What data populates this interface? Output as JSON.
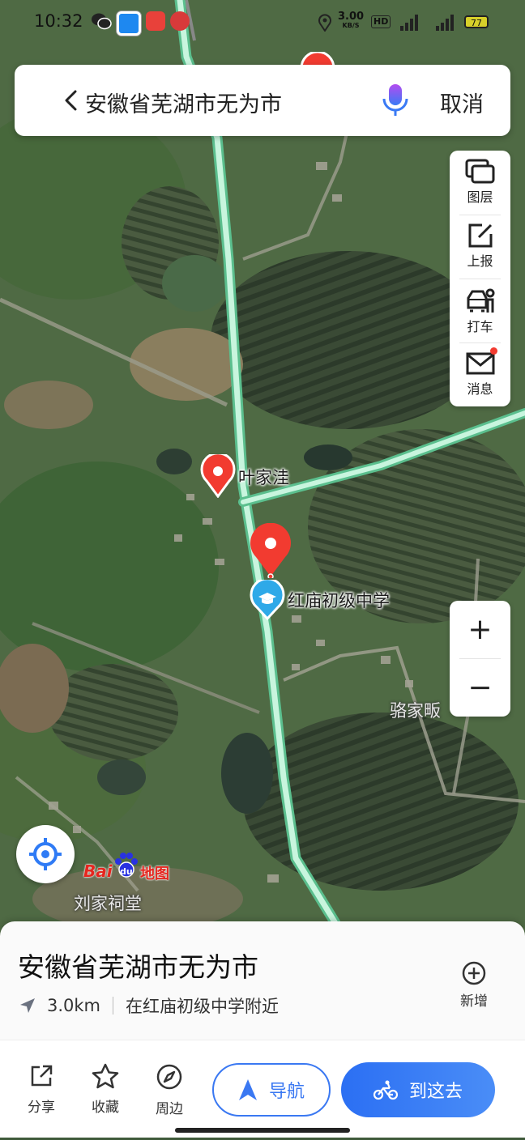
{
  "status_bar": {
    "time": "10:32",
    "net_speed_value": "3.00",
    "net_speed_unit": "KB/S",
    "hd_label": "HD",
    "battery": "77"
  },
  "search": {
    "query": "安徽省芜湖市无为市",
    "cancel_label": "取消"
  },
  "toolbar": {
    "layers_label": "图层",
    "report_label": "上报",
    "taxi_label": "打车",
    "message_label": "消息"
  },
  "zoom": {
    "in_label": "+",
    "out_label": "−"
  },
  "map": {
    "labels": {
      "yejiawa": "叶家洼",
      "school": "红庙初级中学",
      "luojia": "骆家畈",
      "liujia": "刘家祠堂"
    },
    "logo_bai": "Bai",
    "logo_du": "du",
    "logo_map": "地图"
  },
  "info_card": {
    "place_name": "安徽省芜湖市无为市",
    "distance": "3.0km",
    "nearby": "在红庙初级中学附近",
    "add_label": "新增"
  },
  "actions": {
    "share_label": "分享",
    "favorite_label": "收藏",
    "nearby_label": "周边",
    "navigate_label": "导航",
    "go_label": "到这去"
  },
  "colors": {
    "accent_blue": "#3a78f2",
    "pin_red": "#f23b30",
    "road_green": "#7de3b0"
  }
}
